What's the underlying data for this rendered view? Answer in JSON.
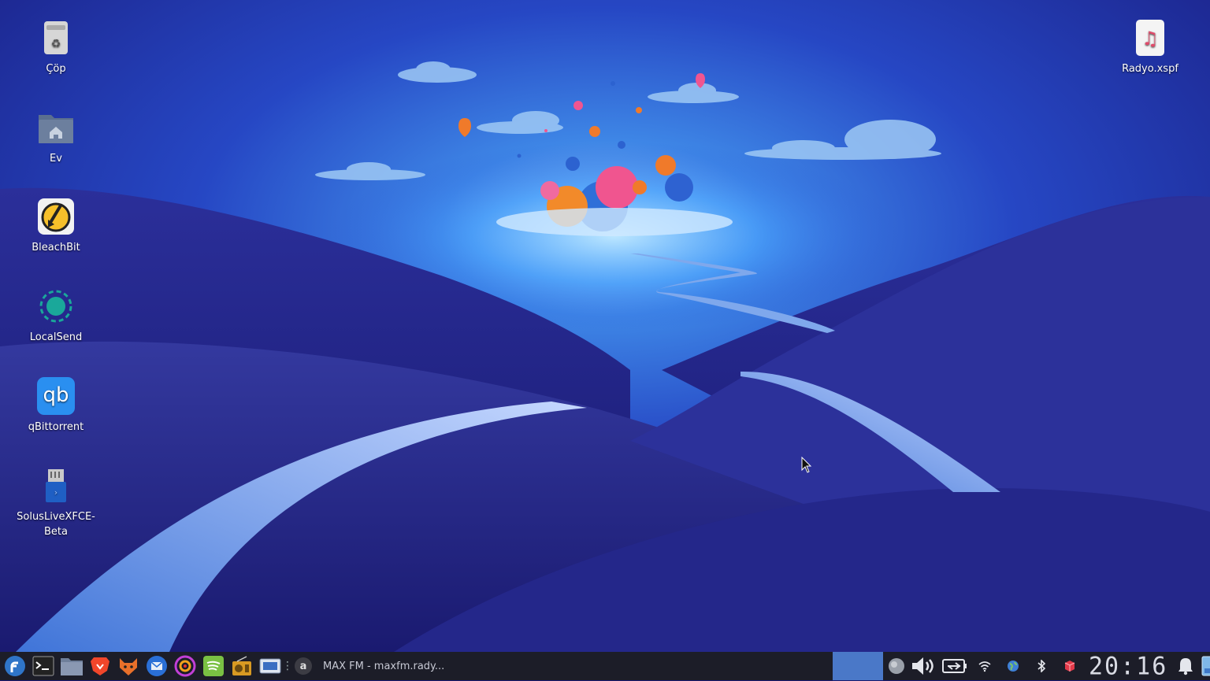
{
  "desktop": {
    "icons_left": [
      {
        "label": "Çöp",
        "icon": "trash-icon"
      },
      {
        "label": "Ev",
        "icon": "home-folder-icon"
      },
      {
        "label": "BleachBit",
        "icon": "bleachbit-icon"
      },
      {
        "label": "LocalSend",
        "icon": "localsend-icon"
      },
      {
        "label": "qBittorrent",
        "icon": "qbittorrent-icon",
        "text": "qb"
      },
      {
        "label": "SolusLiveXFCE-Beta",
        "icon": "usb-drive-icon"
      }
    ],
    "icons_right": [
      {
        "label": "Radyo.xspf",
        "icon": "music-file-icon"
      }
    ]
  },
  "taskbar": {
    "launchers": [
      "fedora-menu-icon",
      "terminal-icon",
      "file-manager-icon",
      "brave-browser-icon",
      "librewolf-icon",
      "thunderbird-icon",
      "obs-icon",
      "spotify-icon",
      "radio-icon",
      "screenshot-icon"
    ],
    "separator": "⋮",
    "task": {
      "badge": "a",
      "title": "MAX FM - maxfm.rady..."
    },
    "tray": [
      "weather-icon",
      "volume-icon",
      "battery-icon",
      "wifi-icon",
      "network-globe-icon",
      "bluetooth-icon",
      "package-icon"
    ],
    "clock": "20:16",
    "accent": "#4a78c8"
  }
}
